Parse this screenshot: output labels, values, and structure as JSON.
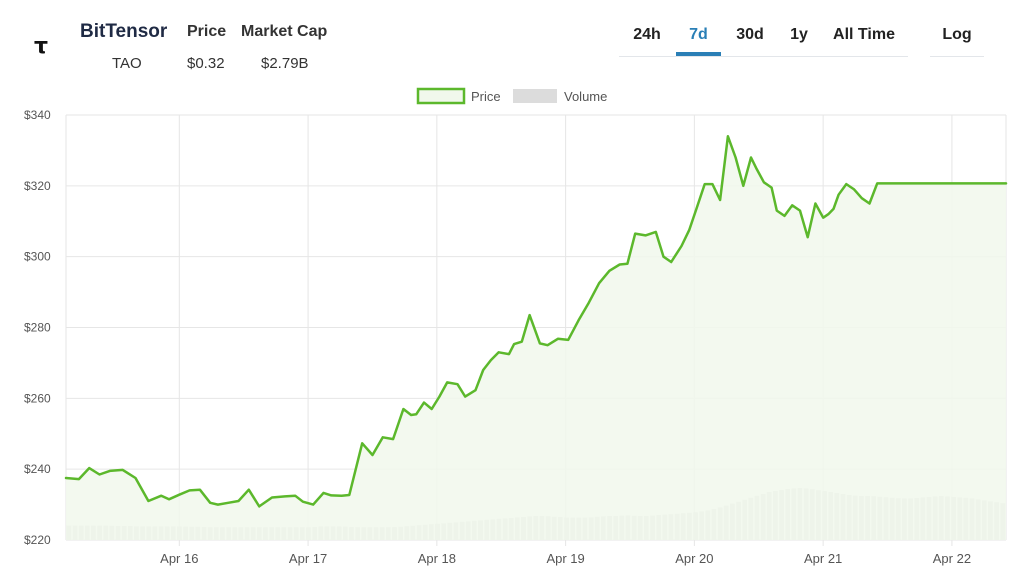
{
  "header": {
    "logo_glyph": "τ",
    "coin_name": "BitTensor",
    "symbol": "TAO",
    "price_label": "Price",
    "price_value": "$0.32",
    "mcap_label": "Market Cap",
    "mcap_value": "$2.79B"
  },
  "range_tabs": {
    "items": [
      "24h",
      "7d",
      "30d",
      "1y",
      "All Time"
    ],
    "selected": "7d",
    "log_label": "Log"
  },
  "colors": {
    "price_line": "#5cb82c",
    "price_fill": "#f1f8ec",
    "volume_bar": "#dcdcdc",
    "accent": "#2a7fb6"
  },
  "chart_data": {
    "type": "line",
    "legend": {
      "position": "top-center",
      "items": [
        "Price",
        "Volume"
      ]
    },
    "x_ticks": [
      "Apr 16",
      "Apr 17",
      "Apr 18",
      "Apr 19",
      "Apr 20",
      "Apr 21",
      "Apr 22"
    ],
    "y_ticks": [
      "$220",
      "$240",
      "$260",
      "$280",
      "$300",
      "$320",
      "$340"
    ],
    "ylim": [
      220,
      340
    ],
    "x_range_days": [
      15.12,
      22.42
    ],
    "grid": true,
    "series": [
      {
        "name": "Price",
        "x_days": [
          15.12,
          15.22,
          15.3,
          15.38,
          15.46,
          15.56,
          15.66,
          15.76,
          15.86,
          15.92,
          16.0,
          16.08,
          16.16,
          16.24,
          16.3,
          16.38,
          16.46,
          16.54,
          16.62,
          16.72,
          16.82,
          16.9,
          16.96,
          17.04,
          17.12,
          17.18,
          17.26,
          17.32,
          17.42,
          17.5,
          17.58,
          17.66,
          17.74,
          17.8,
          17.84,
          17.9,
          17.96,
          18.02,
          18.08,
          18.16,
          18.22,
          18.3,
          18.36,
          18.42,
          18.48,
          18.56,
          18.6,
          18.66,
          18.72,
          18.8,
          18.86,
          18.94,
          19.02,
          19.1,
          19.18,
          19.26,
          19.34,
          19.42,
          19.48,
          19.54,
          19.62,
          19.7,
          19.76,
          19.82,
          19.9,
          19.96,
          20.02,
          20.08,
          20.14,
          20.2,
          20.26,
          20.32,
          20.38,
          20.44,
          20.48,
          20.54,
          20.6,
          20.64,
          20.7,
          20.76,
          20.82,
          20.88,
          20.94,
          21.0,
          21.04,
          21.08,
          21.12,
          21.18,
          21.24,
          21.3,
          21.36,
          21.42,
          21.48,
          21.56,
          21.62,
          21.68,
          21.74,
          21.8,
          21.86,
          21.92,
          21.98,
          22.04,
          22.1,
          22.18,
          22.26,
          22.34,
          22.42
        ],
        "values": [
          237.5,
          237.2,
          240.3,
          238.5,
          239.5,
          239.8,
          237.5,
          231.0,
          232.5,
          231.5,
          232.8,
          234.0,
          234.2,
          230.5,
          230.0,
          230.5,
          231.0,
          234.2,
          229.5,
          232.0,
          232.3,
          232.5,
          230.8,
          230.0,
          233.3,
          232.6,
          232.5,
          232.7,
          247.3,
          244.0,
          249.0,
          248.5,
          257.0,
          255.3,
          255.5,
          258.8,
          257.0,
          260.5,
          264.5,
          264.0,
          260.5,
          262.3,
          268.0,
          270.8,
          273.0,
          272.5,
          275.3,
          276.0,
          283.5,
          275.5,
          275.0,
          276.8,
          276.5,
          282.0,
          287.0,
          292.5,
          296.0,
          297.8,
          298.0,
          306.5,
          306.0,
          307.0,
          300.0,
          298.5,
          303.0,
          307.5,
          314.0,
          320.5,
          320.5,
          316.0,
          334.0,
          328.0,
          320.0,
          328.0,
          325.0,
          321.0,
          319.5,
          313.0,
          311.5,
          314.5,
          313.0,
          305.5,
          315.0,
          311.0,
          312.0,
          313.5,
          317.5,
          320.5,
          319.0,
          316.5,
          315.0,
          320.7,
          320.7,
          320.7,
          320.7,
          320.7,
          320.7,
          320.7,
          320.7,
          320.7,
          320.7,
          320.7,
          320.7,
          320.7,
          320.7,
          320.7,
          320.7
        ]
      },
      {
        "name": "Volume",
        "bar_count": 153,
        "relative_values": [
          0.18,
          0.18,
          0.18,
          0.18,
          0.18,
          0.175,
          0.175,
          0.17,
          0.17,
          0.17,
          0.17,
          0.17,
          0.165,
          0.165,
          0.16,
          0.16,
          0.16,
          0.16,
          0.16,
          0.16,
          0.16,
          0.16,
          0.16,
          0.16,
          0.16,
          0.17,
          0.17,
          0.17,
          0.16,
          0.16,
          0.16,
          0.16,
          0.16,
          0.17,
          0.18,
          0.19,
          0.2,
          0.21,
          0.22,
          0.23,
          0.24,
          0.25,
          0.26,
          0.27,
          0.28,
          0.29,
          0.3,
          0.3,
          0.29,
          0.28,
          0.28,
          0.28,
          0.29,
          0.3,
          0.3,
          0.31,
          0.3,
          0.3,
          0.31,
          0.32,
          0.33,
          0.34,
          0.35,
          0.37,
          0.4,
          0.44,
          0.48,
          0.52,
          0.56,
          0.6,
          0.62,
          0.64,
          0.65,
          0.64,
          0.62,
          0.6,
          0.58,
          0.56,
          0.55,
          0.55,
          0.54,
          0.53,
          0.52,
          0.52,
          0.53,
          0.54,
          0.55,
          0.54,
          0.53,
          0.52,
          0.5,
          0.48,
          0.46
        ]
      }
    ]
  }
}
